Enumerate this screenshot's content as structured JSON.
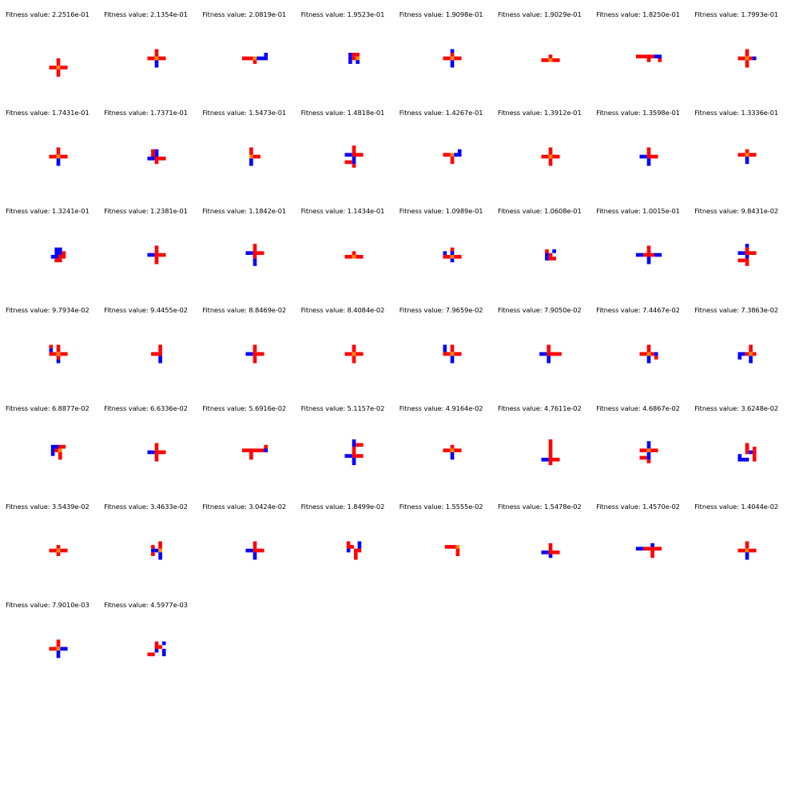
{
  "title_prefix": "Fitness value: ",
  "colors": {
    "red": "#ff0000",
    "blue": "#0000ff",
    "orange": "#ff8800",
    "background": "#ffffff"
  },
  "legend": "r = red segment, b = blue segment, o = orange joint",
  "individuals": [
    {
      "fitness": "2.2516e-01",
      "grid": [
        ".....",
        ".....",
        ".....",
        ".....",
        ".....",
        "..r..",
        "..r..",
        "rrorr",
        "..r..",
        "..r.."
      ]
    },
    {
      "fitness": "2.1354e-01",
      "grid": [
        "..r..",
        "..r..",
        "rrorr",
        "..b..",
        "..b.."
      ]
    },
    {
      "fitness": "2.0819e-01",
      "grid": [
        "......b",
        "rrrobbb",
        "...r..."
      ]
    },
    {
      "fitness": "1.9523e-01",
      "grid": [
        "brr",
        "bro",
        "b.b"
      ]
    },
    {
      "fitness": "1.9098e-01",
      "grid": [
        "..b..",
        "..r..",
        "rrorr",
        "..b..",
        "..b.."
      ]
    },
    {
      "fitness": "1.9029e-01",
      "grid": [
        "..r..",
        "rrorr"
      ]
    },
    {
      "fitness": "1.8250e-01",
      "grid": [
        "rrrrrbb",
        "...r..r"
      ]
    },
    {
      "fitness": "1.7993e-01",
      "grid": [
        "..r..",
        "..r..",
        "rrorb",
        "..r..",
        "..r.."
      ]
    },
    {
      "fitness": "1.7431e-01",
      "grid": [
        "..r..",
        "..r..",
        "rrorr",
        "..b..",
        "..b.."
      ]
    },
    {
      "fitness": "1.7371e-01",
      "grid": [
        ".rb..",
        ".rb..",
        "bbrrr",
        "..r.."
      ]
    },
    {
      "fitness": "1.5473e-01",
      "grid": [
        "r..",
        "r..",
        "orr",
        "b..",
        "b.."
      ]
    },
    {
      "fitness": "1.4818e-01",
      "grid": [
        "..r..",
        "..r..",
        "bbrrr",
        "..b..",
        "rrb..",
        "..r.."
      ]
    },
    {
      "fitness": "1.4267e-01",
      "grid": [
        "....b",
        "rrobb",
        "..r..",
        "..r.."
      ]
    },
    {
      "fitness": "1.3912e-01",
      "grid": [
        "..r..",
        "..r..",
        "rrorr",
        "..r..",
        "..r.."
      ]
    },
    {
      "fitness": "1.3598e-01",
      "grid": [
        "..r..",
        "..r..",
        "bbrrr",
        "..b..",
        "..b.."
      ]
    },
    {
      "fitness": "1.3336e-01",
      "grid": [
        "..r..",
        "rrorr",
        "..b..",
        "..b.."
      ]
    },
    {
      "fitness": "1.3241e-01",
      "grid": [
        ".bb.",
        ".bbr",
        "bbrr",
        ".rr."
      ]
    },
    {
      "fitness": "1.2381e-01",
      "grid": [
        "..r..",
        "..r..",
        "bbrrr",
        "..r..",
        "..r.."
      ]
    },
    {
      "fitness": "1.1842e-01",
      "grid": [
        "..r..",
        "..r..",
        "bbrrr",
        "..r..",
        "..b..",
        "..b.."
      ]
    },
    {
      "fitness": "1.1434e-01",
      "grid": [
        "..r..",
        "rrorr"
      ]
    },
    {
      "fitness": "1.0989e-01",
      "grid": [
        "..r..",
        "b.b..",
        "rrorr",
        "..b.."
      ]
    },
    {
      "fitness": "1.0608e-01",
      "grid": [
        "r.b",
        "br.",
        "brr"
      ]
    },
    {
      "fitness": "1.0015e-01",
      "grid": [
        "...r...",
        "...r...",
        "bbrrrbb",
        "...b...",
        "...b..."
      ]
    },
    {
      "fitness": "9.8431e-02",
      "grid": [
        "..b..",
        "..r..",
        "bbrrr",
        "..b..",
        "rrr..",
        "..r.."
      ]
    },
    {
      "fitness": "9.7934e-02",
      "grid": [
        "r.r..",
        "b.r..",
        "rrorr",
        "..r..",
        "..b.."
      ]
    },
    {
      "fitness": "9.4455e-02",
      "grid": [
        "..r",
        "..r",
        "rrr",
        "..b",
        "..b"
      ]
    },
    {
      "fitness": "8.8469e-02",
      "grid": [
        "..r..",
        "..r..",
        "bbrrr",
        "..r..",
        "..r.."
      ]
    },
    {
      "fitness": "8.4084e-02",
      "grid": [
        "..r..",
        "..r..",
        "rrorr",
        "..r..",
        "..r.."
      ]
    },
    {
      "fitness": "7.9659e-02",
      "grid": [
        "b.r..",
        "b.r..",
        "rrorr",
        "..b..",
        "..b.."
      ]
    },
    {
      "fitness": "7.9050e-02",
      "grid": [
        "..r...",
        "..r...",
        "bbrrrr",
        "..b...",
        "..b..."
      ]
    },
    {
      "fitness": "7.4467e-02",
      "grid": [
        "..r..",
        "..r..",
        "rrorb",
        "..b.r",
        "..b.."
      ]
    },
    {
      "fitness": "7.3863e-02",
      "grid": [
        "...r.",
        "...r.",
        "bbror",
        "b..b.",
        "...b."
      ]
    },
    {
      "fitness": "6.8877e-02",
      "grid": [
        "bbrr",
        "bro.",
        "b.r.",
        "..r."
      ]
    },
    {
      "fitness": "6.6336e-02",
      "grid": [
        "..r..",
        "..r..",
        "bbrrr",
        "..r..",
        "..r.."
      ]
    },
    {
      "fitness": "5.6916e-02",
      "grid": [
        "......r",
        "rrrrrrb",
        "..r....",
        "..r...."
      ]
    },
    {
      "fitness": "5.1157e-02",
      "grid": [
        "..b..",
        "..brr",
        "..r..",
        "..r..",
        "bbrrr",
        "..b..",
        "..b.."
      ]
    },
    {
      "fitness": "4.9164e-02",
      "grid": [
        "..r..",
        "rrorr",
        "..b..",
        "..b.."
      ]
    },
    {
      "fitness": "4.7611e-02",
      "grid": [
        "..r..",
        "..r..",
        "..r..",
        "..r..",
        "..r..",
        "bbrrr",
        "..r.."
      ]
    },
    {
      "fitness": "4.6867e-02",
      "grid": [
        "..b..",
        "..b..",
        "rrorr",
        "..b..",
        "rrb..",
        "..r.."
      ]
    },
    {
      "fitness": "3.6248e-02",
      "grid": [
        "..r..",
        "..r.r",
        "..rbr",
        "b...r",
        "bbb.r"
      ]
    },
    {
      "fitness": "3.5439e-02",
      "grid": [
        "..r..",
        "rrorr",
        "..r.."
      ]
    },
    {
      "fitness": "3.4633e-02",
      "grid": [
        "..r",
        "r.r",
        "bbo",
        "r.b",
        "..b"
      ]
    },
    {
      "fitness": "3.0424e-02",
      "grid": [
        "..r..",
        "..r..",
        "bbrrr",
        "..b..",
        "..b.."
      ]
    },
    {
      "fitness": "1.8499e-02",
      "grid": [
        "r..b",
        "rr.b",
        "b.rr",
        "..r.",
        "..r."
      ]
    },
    {
      "fitness": "1.5555e-02",
      "grid": [
        "rrro",
        "...r",
        "...r"
      ]
    },
    {
      "fitness": "1.5478e-02",
      "grid": [
        "..r..",
        "..r..",
        "bbrrr",
        "..b.."
      ]
    },
    {
      "fitness": "1.4570e-02",
      "grid": [
        "....b..",
        "bbrrrrr",
        "....r..",
        "....r.."
      ]
    },
    {
      "fitness": "1.4044e-02",
      "grid": [
        "..r..",
        "..r..",
        "rrorr",
        "..b..",
        "..b.."
      ]
    },
    {
      "fitness": "7.9010e-03",
      "grid": [
        "..r..",
        "..r..",
        "rrobb",
        "..b..",
        "..b.."
      ]
    },
    {
      "fitness": "4.5977e-03",
      "grid": [
        "..r.b",
        "..rr.",
        "..b.b",
        "rr..b"
      ]
    }
  ]
}
